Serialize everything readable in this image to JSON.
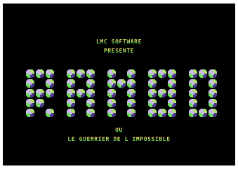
{
  "screen": {
    "background": "#000000",
    "text_colors": {
      "top": "#e8e86a",
      "bottom": "#6ee05a"
    },
    "line1": "LMC SOFTWARE",
    "line2": "PRESENTE",
    "line3": "OU",
    "line4": "LE GUERRIER DE L IMPOSSIBLE"
  },
  "logo": {
    "title": "RAMBO",
    "block_icon": "faceted-gem-block",
    "block_colors": [
      "#c9b8e8",
      "#8a78c4",
      "#6ee05a",
      "#b0e070",
      "#4a3a8a"
    ],
    "letters": [
      {
        "rows": [
          "111",
          "101",
          "111",
          "110",
          "101"
        ]
      },
      {
        "rows": [
          "111",
          "101",
          "111",
          "101",
          "101"
        ]
      },
      {
        "rows": [
          "101",
          "111",
          "101",
          "101",
          "101"
        ]
      },
      {
        "rows": [
          "111",
          "101",
          "111",
          "101",
          "111"
        ]
      },
      {
        "rows": [
          "111",
          "101",
          "101",
          "101",
          "111"
        ]
      }
    ]
  }
}
